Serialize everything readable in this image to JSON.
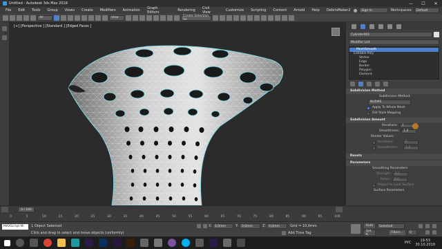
{
  "window": {
    "title": "Untitled - Autodesk 3ds Max 2018",
    "controls": [
      "—",
      "☐",
      "✕"
    ]
  },
  "menu": [
    "File",
    "Edit",
    "Tools",
    "Group",
    "Views",
    "Create",
    "Modifiers",
    "Animation",
    "Graph Editors",
    "Rendering",
    "Civil View",
    "Customize",
    "Scripting",
    "Content",
    "Arnold",
    "Help",
    "DebrisMaker2"
  ],
  "account": {
    "signin": "Sign In",
    "workspaces_label": "Workspaces:",
    "workspace": "Default"
  },
  "toolbar": {
    "filter": "All",
    "view": "View",
    "selection_set": "Create Selection Se"
  },
  "viewport": {
    "label": "[+] [Perspective ] [Standard ] [Edged Faces ]"
  },
  "command_panel": {
    "object_name": "Cylinder001",
    "modifier_list": "Modifier List",
    "stack": [
      {
        "label": "MeshSmooth",
        "kind": "top"
      },
      {
        "label": "Editable Poly",
        "kind": "sub"
      },
      {
        "label": "Vertex",
        "kind": "child"
      },
      {
        "label": "Edge",
        "kind": "child"
      },
      {
        "label": "Border",
        "kind": "child"
      },
      {
        "label": "Polygon",
        "kind": "child"
      },
      {
        "label": "Element",
        "kind": "child"
      }
    ],
    "subdivision_method": {
      "header": "Subdivision Method",
      "label": "Subdivision Method:",
      "value": "NURMS",
      "apply_whole_mesh": "Apply To Whole Mesh",
      "old_style": "Old Style Mapping"
    },
    "subdivision_amount": {
      "header": "Subdivision Amount",
      "iterations_label": "Iterations:",
      "iterations": "1",
      "smoothness_label": "Smoothness:",
      "smoothness": "1,0",
      "render_values": "Render Values:",
      "r_iterations": "Iterations:",
      "r_iterations_val": "0",
      "r_smoothness": "Smoothness:",
      "r_smoothness_val": "1,0"
    },
    "resets": {
      "header": "Resets"
    },
    "parameters": {
      "header": "Parameters",
      "smoothing": "Smoothing Parameters",
      "strength_label": "Strength:",
      "strength": "0,5",
      "relax_label": "Relax:",
      "relax": "0,0",
      "project": "Project to Limit Surface",
      "surface": "Surface Parameters"
    }
  },
  "timeslider": {
    "frame": "0 / 100"
  },
  "trackbar": {
    "ticks": [
      "0",
      "5",
      "10",
      "15",
      "20",
      "25",
      "30",
      "35",
      "40",
      "45",
      "50",
      "55",
      "60",
      "65",
      "70",
      "75",
      "80",
      "85",
      "90",
      "95",
      "100"
    ]
  },
  "status": {
    "maxscript": "MAXScript Mi",
    "selected": "1 Object Selected",
    "prompt": "Click and drag to select and move objects (uniformly)",
    "x": "0,0mm",
    "y": "0,0mm",
    "z": "0,0mm",
    "grid": "Grid = 10,0mm",
    "add_time_tag": "Add Time Tag",
    "auto": "Auto",
    "set_k": "Set K.",
    "selected_dd": "Selected",
    "filters": "Filters...",
    "frame": "0"
  },
  "taskbar": {
    "time": "19:53",
    "date": "30.10.2019",
    "lang": "РУС"
  },
  "colors": {
    "selection": "#7fd7e6",
    "stack_highlight": "#4f7fc8",
    "cursor": "#e08a1e"
  }
}
